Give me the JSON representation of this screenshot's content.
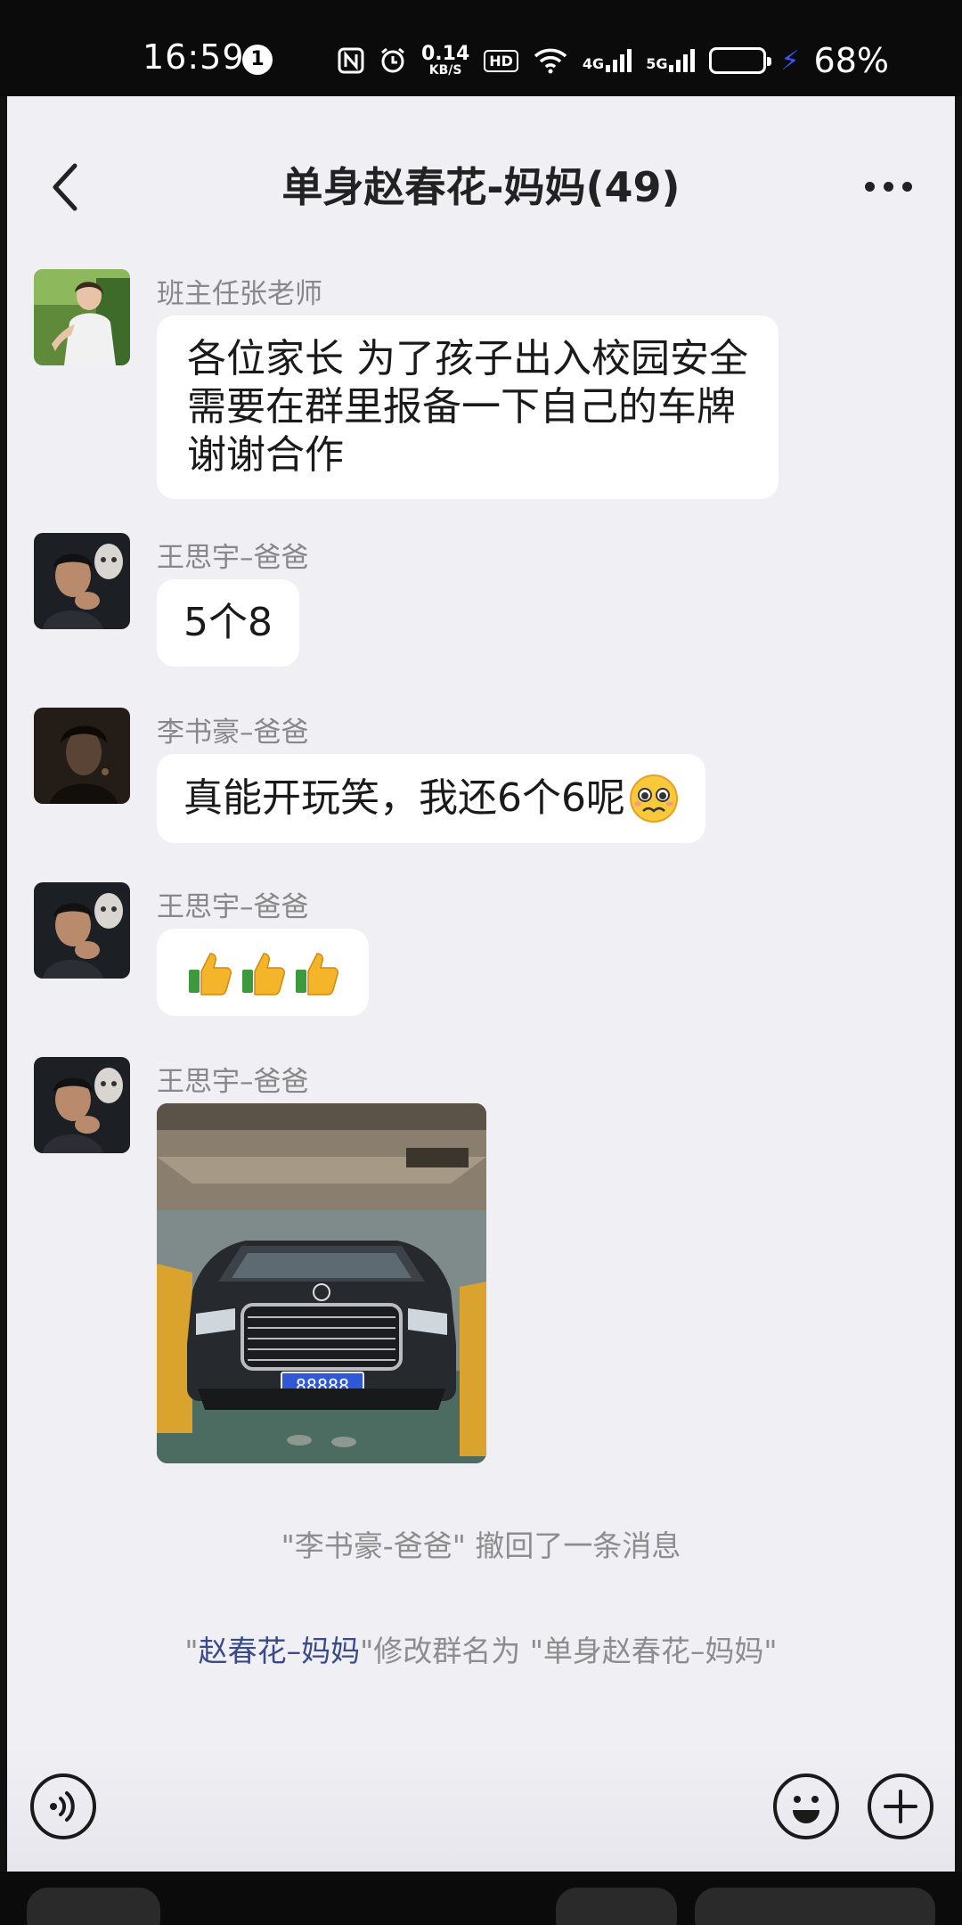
{
  "status_bar": {
    "time": "16:59",
    "notification_count": "1",
    "net_speed_value": "0.14",
    "net_speed_unit": "KB/S",
    "hd_label": "HD",
    "net_4g": "4G",
    "net_5g": "5G",
    "battery_percent": "68%",
    "battery_level": 0.7,
    "charging": true
  },
  "chat": {
    "title": "单身赵春花-妈妈(49)",
    "icons": {
      "back": "chevron-left-icon",
      "more": "more-horizontal-icon"
    },
    "messages": [
      {
        "sender": "班主任张老师",
        "lines": [
          "各位家长 为了孩子出入校园安全",
          "需要在群里报备一下自己的车牌",
          "谢谢合作"
        ]
      },
      {
        "sender": "王思宇–爸爸",
        "text": "5个8"
      },
      {
        "sender": "李书豪–爸爸",
        "text": "真能开玩笑，我还6个6呢",
        "emoji": "pleading-face-emoji"
      },
      {
        "sender": "王思宇–爸爸",
        "emoji_text": "👍👍👍"
      },
      {
        "sender": "王思宇–爸爸",
        "image": {
          "plate": "88888"
        }
      }
    ],
    "system_notices": {
      "recall": "\"李书豪-爸爸\" 撤回了一条消息",
      "rename_prefix": "\"",
      "rename_name": "赵春花–妈妈",
      "rename_suffix": "\"修改群名为 \"单身赵春花–妈妈\""
    }
  },
  "input_bar": {
    "icons": {
      "voice": "voice-icon",
      "emoji": "emoji-icon",
      "plus": "plus-icon"
    }
  },
  "colors": {
    "background": "#efeff4",
    "bubble": "#ffffff",
    "highlight_name": "#3a4a8c",
    "battery_fill": "#3b3fe0"
  }
}
